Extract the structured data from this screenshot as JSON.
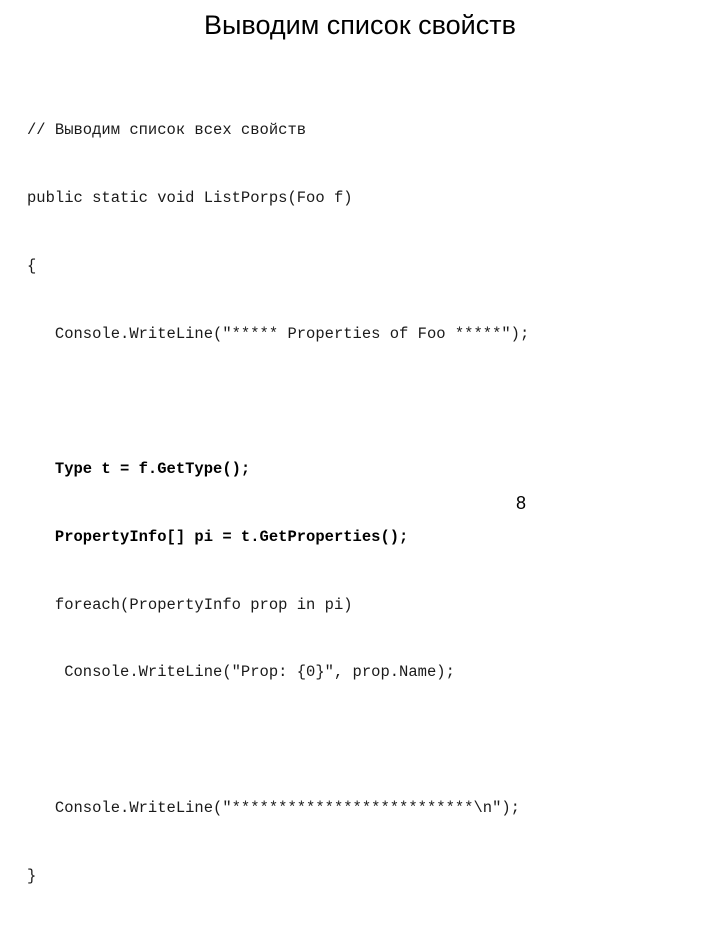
{
  "slide": {
    "title": "Выводим список свойств",
    "page_number": "8",
    "code_lines": [
      {
        "text": "// Выводим список всех свойств",
        "bold": false
      },
      {
        "text": "public static void ListPorps(Foo f)",
        "bold": false
      },
      {
        "text": "{",
        "bold": false
      },
      {
        "text": "   Console.WriteLine(\"***** Properties of Foo *****\");",
        "bold": false
      },
      {
        "text": "",
        "bold": false
      },
      {
        "text": "   Type t = f.GetType();",
        "bold": true
      },
      {
        "text": "   PropertyInfo[] pi = t.GetProperties();",
        "bold": true
      },
      {
        "text": "   foreach(PropertyInfo prop in pi)",
        "bold": false
      },
      {
        "text": "    Console.WriteLine(\"Prop: {0}\", prop.Name);",
        "bold": false
      },
      {
        "text": "",
        "bold": false
      },
      {
        "text": "   Console.WriteLine(\"**************************\\n\");",
        "bold": false
      },
      {
        "text": "}",
        "bold": false
      }
    ]
  }
}
